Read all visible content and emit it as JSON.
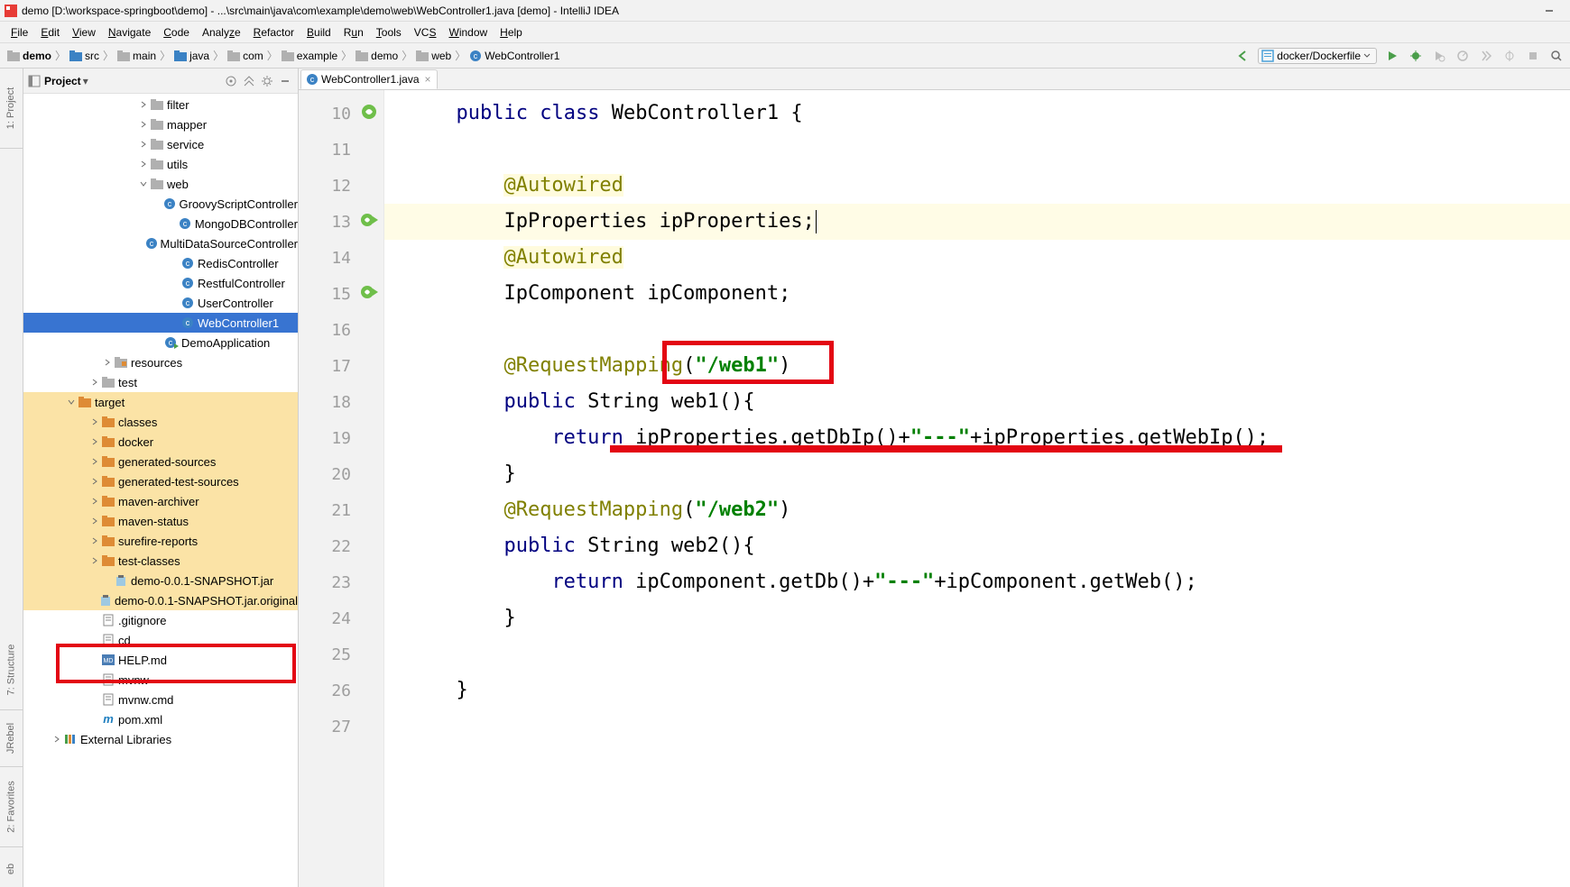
{
  "title": "demo [D:\\workspace-springboot\\demo] - ...\\src\\main\\java\\com\\example\\demo\\web\\WebController1.java [demo] - IntelliJ IDEA",
  "menu": [
    "File",
    "Edit",
    "View",
    "Navigate",
    "Code",
    "Analyze",
    "Refactor",
    "Build",
    "Run",
    "Tools",
    "VCS",
    "Window",
    "Help"
  ],
  "breadcrumb": [
    "demo",
    "src",
    "main",
    "java",
    "com",
    "example",
    "demo",
    "web",
    "WebController1"
  ],
  "runConfig": "docker/Dockerfile",
  "projectPanel": {
    "title": "Project"
  },
  "gutterTabs": {
    "project": "1: Project",
    "structure": "7: Structure",
    "favorites": "2: Favorites",
    "jrebel": "JRebel",
    "web": "eb"
  },
  "tree": {
    "items": [
      {
        "pad": 126,
        "arrow": ">",
        "icon": "folder-gray",
        "label": "filter"
      },
      {
        "pad": 126,
        "arrow": ">",
        "icon": "folder-gray",
        "label": "mapper"
      },
      {
        "pad": 126,
        "arrow": ">",
        "icon": "folder-gray",
        "label": "service"
      },
      {
        "pad": 126,
        "arrow": ">",
        "icon": "folder-gray",
        "label": "utils"
      },
      {
        "pad": 126,
        "arrow": "v",
        "icon": "folder-gray",
        "label": "web"
      },
      {
        "pad": 160,
        "arrow": "",
        "icon": "class",
        "label": "GroovyScriptController"
      },
      {
        "pad": 160,
        "arrow": "",
        "icon": "class",
        "label": "MongoDBController"
      },
      {
        "pad": 160,
        "arrow": "",
        "icon": "class",
        "label": "MultiDataSourceController"
      },
      {
        "pad": 160,
        "arrow": "",
        "icon": "class",
        "label": "RedisController"
      },
      {
        "pad": 160,
        "arrow": "",
        "icon": "class",
        "label": "RestfulController"
      },
      {
        "pad": 160,
        "arrow": "",
        "icon": "class",
        "label": "UserController"
      },
      {
        "pad": 160,
        "arrow": "",
        "icon": "class",
        "label": "WebController1",
        "sel": true
      },
      {
        "pad": 142,
        "arrow": "",
        "icon": "class-run",
        "label": "DemoApplication"
      },
      {
        "pad": 86,
        "arrow": ">",
        "icon": "folder-res",
        "label": "resources"
      },
      {
        "pad": 72,
        "arrow": ">",
        "icon": "folder-gray",
        "label": "test"
      },
      {
        "pad": 46,
        "arrow": "v",
        "icon": "folder-orange",
        "label": "target",
        "tgt": true
      },
      {
        "pad": 72,
        "arrow": ">",
        "icon": "folder-orange",
        "label": "classes",
        "tgt": true
      },
      {
        "pad": 72,
        "arrow": ">",
        "icon": "folder-orange",
        "label": "docker",
        "tgt": true
      },
      {
        "pad": 72,
        "arrow": ">",
        "icon": "folder-orange",
        "label": "generated-sources",
        "tgt": true
      },
      {
        "pad": 72,
        "arrow": ">",
        "icon": "folder-orange",
        "label": "generated-test-sources",
        "tgt": true
      },
      {
        "pad": 72,
        "arrow": ">",
        "icon": "folder-orange",
        "label": "maven-archiver",
        "tgt": true
      },
      {
        "pad": 72,
        "arrow": ">",
        "icon": "folder-orange",
        "label": "maven-status",
        "tgt": true
      },
      {
        "pad": 72,
        "arrow": ">",
        "icon": "folder-orange",
        "label": "surefire-reports",
        "tgt": true
      },
      {
        "pad": 72,
        "arrow": ">",
        "icon": "folder-orange",
        "label": "test-classes",
        "tgt": true
      },
      {
        "pad": 86,
        "arrow": "",
        "icon": "jar",
        "label": "demo-0.0.1-SNAPSHOT.jar",
        "tgt": true
      },
      {
        "pad": 86,
        "arrow": "",
        "icon": "jar",
        "label": "demo-0.0.1-SNAPSHOT.jar.original",
        "tgt": true
      },
      {
        "pad": 72,
        "arrow": "",
        "icon": "file",
        "label": ".gitignore"
      },
      {
        "pad": 72,
        "arrow": "",
        "icon": "file",
        "label": "cd"
      },
      {
        "pad": 72,
        "arrow": "",
        "icon": "md",
        "label": "HELP.md"
      },
      {
        "pad": 72,
        "arrow": "",
        "icon": "file",
        "label": "mvnw"
      },
      {
        "pad": 72,
        "arrow": "",
        "icon": "file",
        "label": "mvnw.cmd"
      },
      {
        "pad": 72,
        "arrow": "",
        "icon": "maven",
        "label": "pom.xml"
      }
    ],
    "extlib": "External Libraries"
  },
  "editorTab": "WebController1.java",
  "code": {
    "lines": [
      10,
      11,
      12,
      13,
      14,
      15,
      16,
      17,
      18,
      19,
      20,
      21,
      22,
      23,
      24,
      25,
      26,
      27
    ]
  }
}
